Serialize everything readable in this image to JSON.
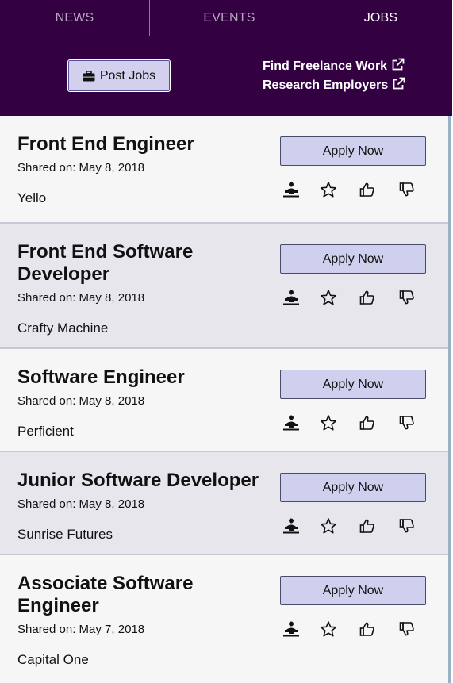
{
  "tabs": [
    {
      "label": "NEWS",
      "active": false
    },
    {
      "label": "EVENTS",
      "active": false
    },
    {
      "label": "JOBS",
      "active": true
    }
  ],
  "header": {
    "post_button": {
      "icon": "briefcase-icon",
      "label": "Post Jobs"
    },
    "links": [
      {
        "label": "Find Freelance Work",
        "icon": "external-link-icon"
      },
      {
        "label": "Research Employers",
        "icon": "external-link-icon"
      }
    ]
  },
  "jobs": [
    {
      "title": "Front End Engineer",
      "shared": "Shared on: May 8, 2018",
      "company": "Yello",
      "apply_label": "Apply Now"
    },
    {
      "title": "Front End Software Developer",
      "shared": "Shared on: May 8, 2018",
      "company": "Crafty Machine",
      "apply_label": "Apply Now"
    },
    {
      "title": "Software Engineer",
      "shared": "Shared on: May 8, 2018",
      "company": "Perficient",
      "apply_label": "Apply Now"
    },
    {
      "title": "Junior Software Developer",
      "shared": "Shared on: May 8, 2018",
      "company": "Sunrise Futures",
      "apply_label": "Apply Now"
    },
    {
      "title": "Associate Software Engineer",
      "shared": "Shared on: May 7, 2018",
      "company": "Capital One",
      "apply_label": "Apply Now"
    }
  ],
  "job_actions": [
    "applied-desk-icon",
    "star-icon",
    "thumbs-up-icon",
    "thumbs-down-icon"
  ],
  "colors": {
    "header_bg": "#330042",
    "button_bg": "#cfd0ee",
    "card_light": "#f6f6f6",
    "card_dark": "#e7e6ec"
  }
}
